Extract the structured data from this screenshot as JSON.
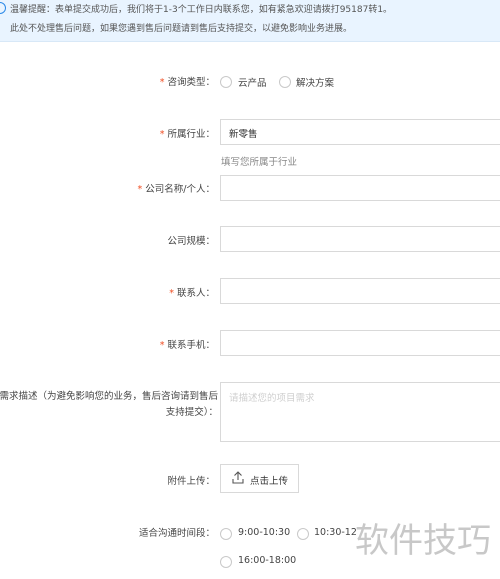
{
  "notice": {
    "line1": "温馨提醒：表单提交成功后，我们将于1-3个工作日内联系您，如有紧急欢迎请拨打95187转1。",
    "line2": "此处不处理售后问题，如果您遇到售后问题请到售后支持提交，以避免影响业务进展。"
  },
  "form": {
    "required_mark": "*",
    "consult_type": {
      "label": "咨询类型：",
      "options": [
        "云产品",
        "解决方案"
      ]
    },
    "industry": {
      "label": "所属行业：",
      "value": "新零售",
      "hint": "填写您所属于行业"
    },
    "company_name": {
      "label": "公司名称/个人：",
      "value": ""
    },
    "company_size": {
      "label": "公司规模：",
      "value": ""
    },
    "contact": {
      "label": "联系人：",
      "value": ""
    },
    "phone": {
      "label": "联系手机：",
      "value": ""
    },
    "description": {
      "label": "需求描述（为避免影响您的业务，售后咨询请到售后支持提交）：",
      "placeholder": "请描述您的项目需求"
    },
    "attachment": {
      "label": "附件上传：",
      "button": "点击上传"
    },
    "contact_time": {
      "label": "适合沟通时间段：",
      "options": [
        "9:00-10:30",
        "10:30-12",
        "16:00-18:00"
      ]
    }
  },
  "watermark": "软件技巧"
}
